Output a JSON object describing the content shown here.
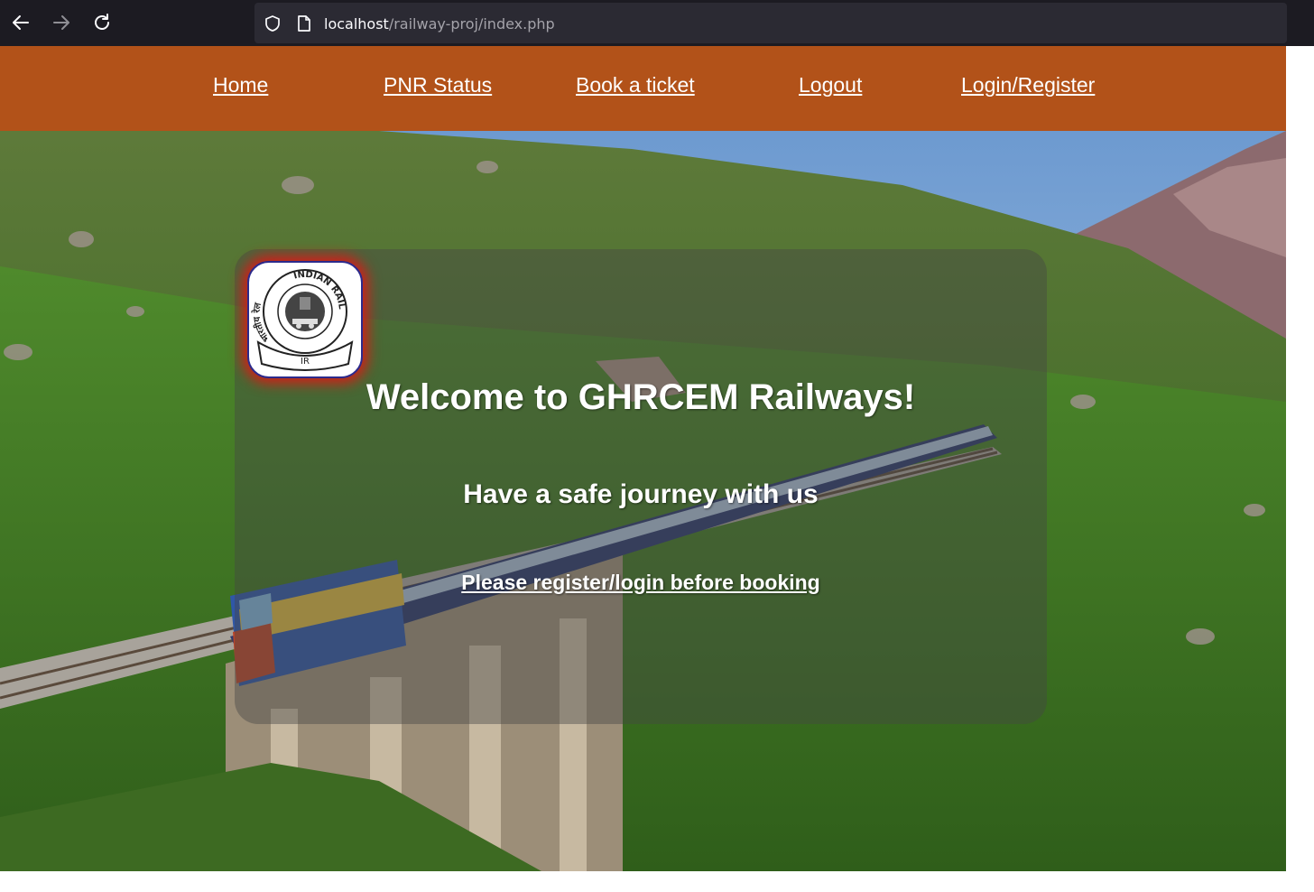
{
  "browser": {
    "url_host": "localhost",
    "url_path": "/railway-proj/index.php",
    "icons": [
      "back-arrow-icon",
      "forward-arrow-icon",
      "reload-icon",
      "shield-icon",
      "page-icon"
    ]
  },
  "navbar": {
    "background": "#b25219",
    "links": [
      {
        "label": "Home"
      },
      {
        "label": "PNR Status"
      },
      {
        "label": "Book a ticket"
      },
      {
        "label": "Logout"
      },
      {
        "label": "Login/Register"
      }
    ]
  },
  "hero": {
    "logo": {
      "top_text": "INDIAN RAILWAYS",
      "side_text": "भारतीय रेल",
      "ribbon_text": "IR"
    },
    "welcome": "Welcome to GHRCEM Railways!",
    "tagline": "Have a safe journey with us",
    "notice_link": "Please register/login before booking"
  }
}
